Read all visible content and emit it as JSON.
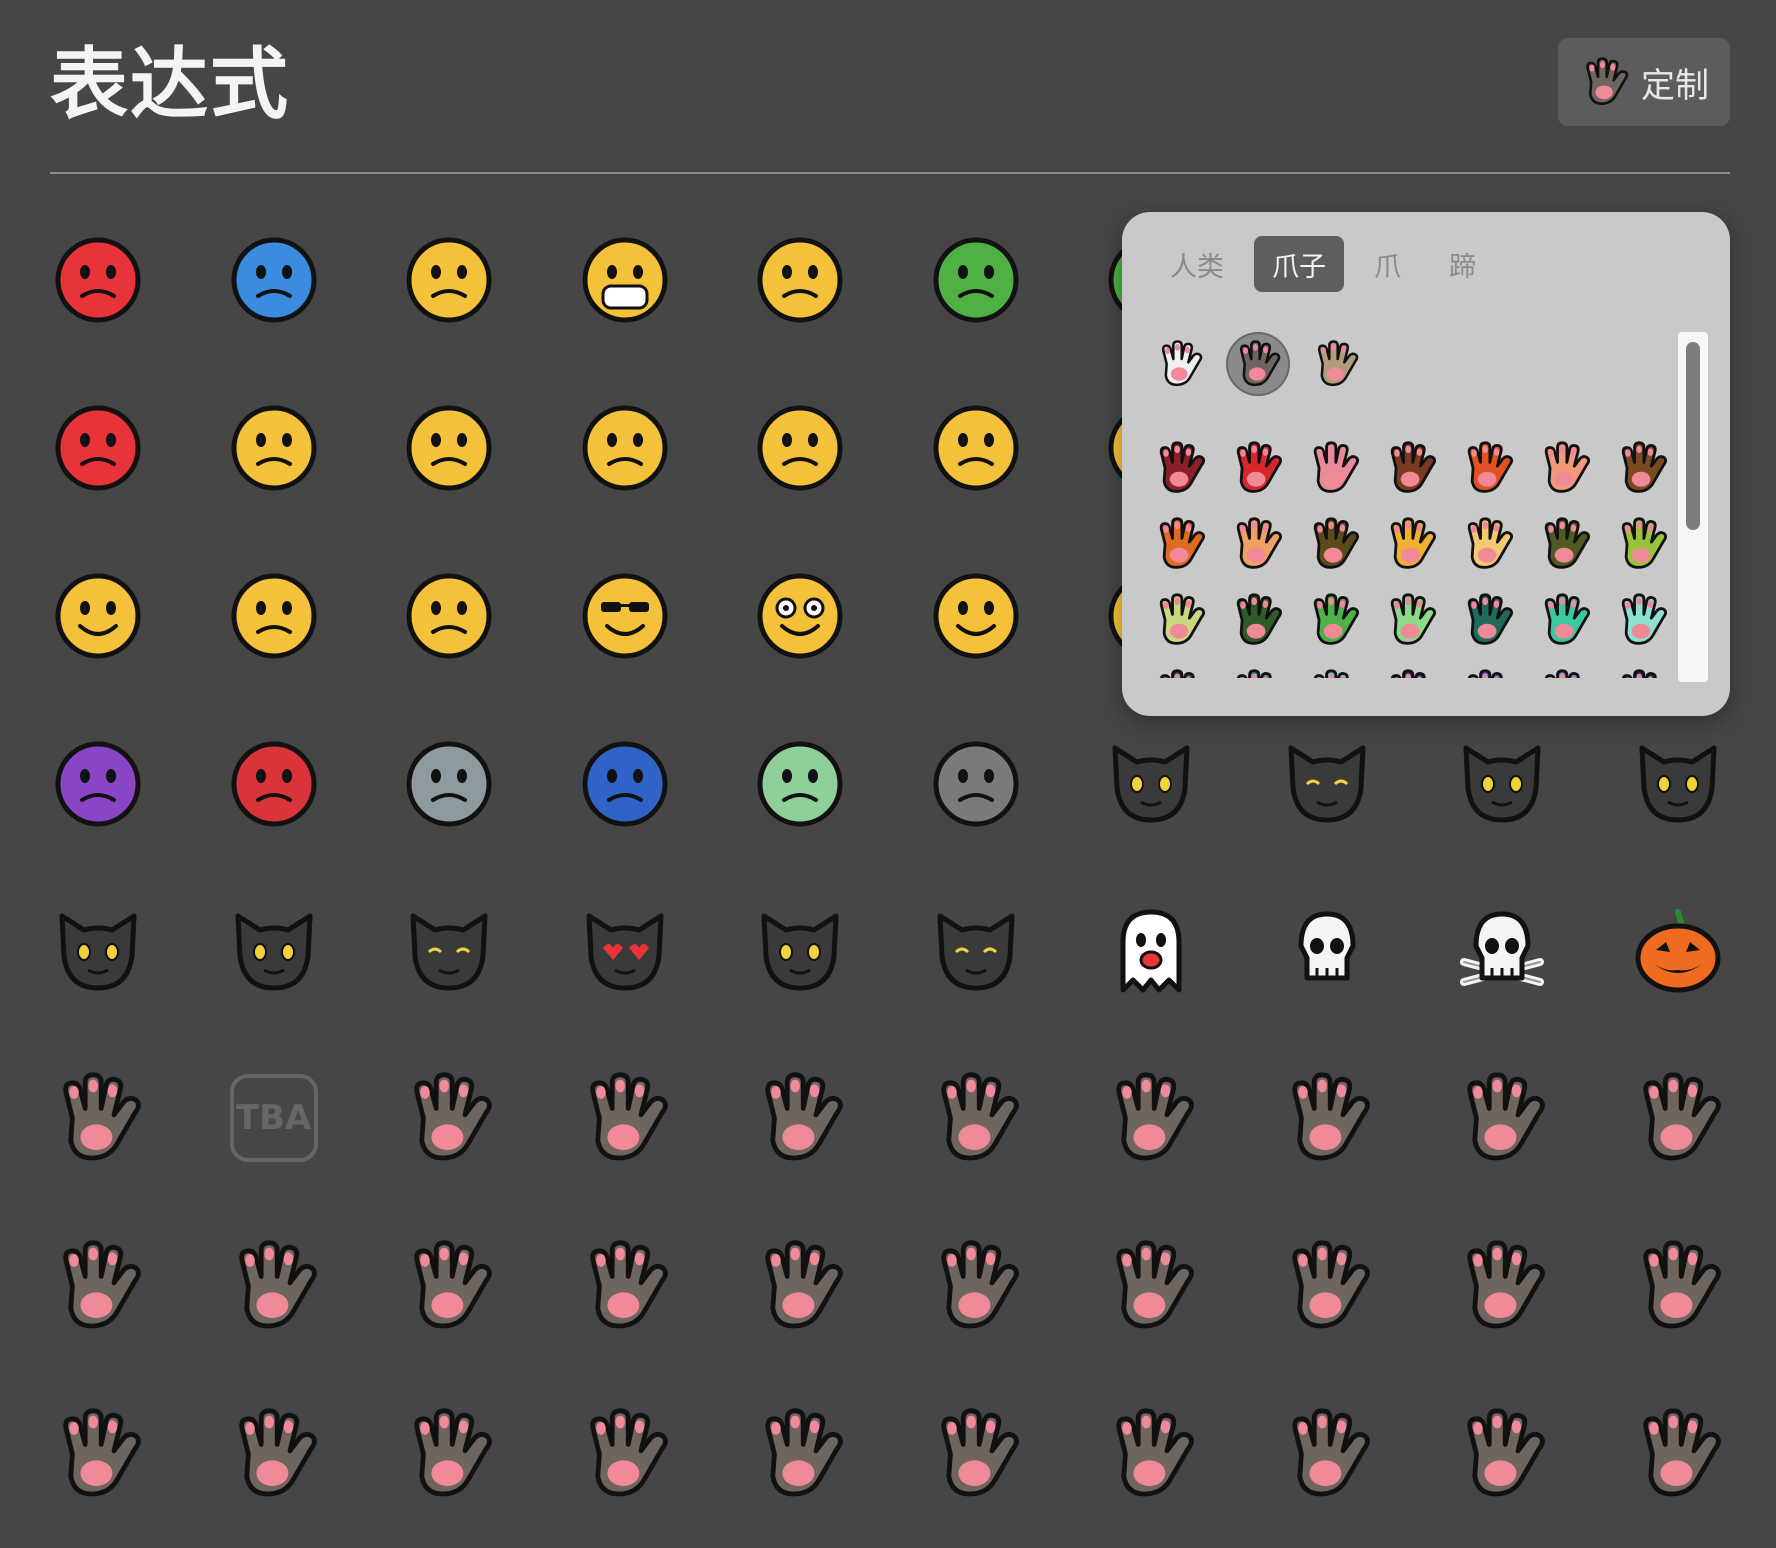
{
  "header": {
    "title": "表达式",
    "customize_label": "定制",
    "customize_icon": "paw-hand-icon"
  },
  "emoji_grid": [
    {
      "name": "angry-sweat-face",
      "icon": "face",
      "color": "#e8333a"
    },
    {
      "name": "freezing-face",
      "icon": "face",
      "color": "#3b8be0"
    },
    {
      "name": "bandaged-face",
      "icon": "face",
      "color": "#f4c13a"
    },
    {
      "name": "mask-face",
      "icon": "face",
      "color": "#f4c13a"
    },
    {
      "name": "vomiting-face",
      "icon": "face",
      "color": "#f4c13a"
    },
    {
      "name": "thermometer-face",
      "icon": "face",
      "color": "#4fb044"
    },
    {
      "name": "sick-face",
      "icon": "face",
      "color": "#4fb044"
    },
    {
      "name": "blank-1",
      "icon": "none",
      "color": ""
    },
    {
      "name": "blank-2",
      "icon": "none",
      "color": ""
    },
    {
      "name": "blank-3",
      "icon": "none",
      "color": ""
    },
    {
      "name": "angry-red-face",
      "icon": "face",
      "color": "#e8333a"
    },
    {
      "name": "cursing-face",
      "icon": "face",
      "color": "#f4c13a"
    },
    {
      "name": "sad-sweat-face",
      "icon": "face",
      "color": "#f4c13a"
    },
    {
      "name": "confused-face",
      "icon": "face",
      "color": "#f4c13a"
    },
    {
      "name": "frowning-face",
      "icon": "face",
      "color": "#f4c13a"
    },
    {
      "name": "sad-face",
      "icon": "face",
      "color": "#f4c13a"
    },
    {
      "name": "worried-face",
      "icon": "face",
      "color": "#f4c13a"
    },
    {
      "name": "blank-4",
      "icon": "none",
      "color": ""
    },
    {
      "name": "blank-5",
      "icon": "none",
      "color": ""
    },
    {
      "name": "blank-6",
      "icon": "none",
      "color": ""
    },
    {
      "name": "smile-sweat-face",
      "icon": "face",
      "color": "#f4c13a"
    },
    {
      "name": "tear-face",
      "icon": "face",
      "color": "#f4c13a"
    },
    {
      "name": "crying-face",
      "icon": "face",
      "color": "#f4c13a"
    },
    {
      "name": "sunglasses-face",
      "icon": "face",
      "color": "#f4c13a"
    },
    {
      "name": "nerd-face",
      "icon": "face",
      "color": "#f4c13a"
    },
    {
      "name": "cowboy-face",
      "icon": "face",
      "color": "#f4c13a"
    },
    {
      "name": "clown-face",
      "icon": "face",
      "color": "#f4c13a"
    },
    {
      "name": "blank-7",
      "icon": "none",
      "color": ""
    },
    {
      "name": "blank-8",
      "icon": "none",
      "color": ""
    },
    {
      "name": "blank-9",
      "icon": "none",
      "color": ""
    },
    {
      "name": "devil-face",
      "icon": "face",
      "color": "#8a45c7"
    },
    {
      "name": "ogre-face",
      "icon": "face",
      "color": "#d8343a"
    },
    {
      "name": "robot-face",
      "icon": "face",
      "color": "#8f9aa0"
    },
    {
      "name": "space-invader",
      "icon": "face",
      "color": "#2f63c8"
    },
    {
      "name": "alien-face",
      "icon": "face",
      "color": "#8fcf9a"
    },
    {
      "name": "block-face",
      "icon": "face",
      "color": "#7a7a7a"
    },
    {
      "name": "cat-face-grin",
      "icon": "cat",
      "color": "#3a3a3a"
    },
    {
      "name": "cat-face-smile",
      "icon": "cat",
      "color": "#3a3a3a"
    },
    {
      "name": "cat-face-tears",
      "icon": "cat",
      "color": "#3a3a3a"
    },
    {
      "name": "cat-face-smirk",
      "icon": "cat",
      "color": "#3a3a3a"
    },
    {
      "name": "cat-face-angry",
      "icon": "cat",
      "color": "#3a3a3a"
    },
    {
      "name": "cat-face-sweat",
      "icon": "cat",
      "color": "#3a3a3a"
    },
    {
      "name": "cat-face-kiss",
      "icon": "cat",
      "color": "#3a3a3a"
    },
    {
      "name": "cat-face-hearts",
      "icon": "cat",
      "color": "#3a3a3a"
    },
    {
      "name": "cat-face-shocked",
      "icon": "cat",
      "color": "#3a3a3a"
    },
    {
      "name": "cat-face-content",
      "icon": "cat",
      "color": "#3a3a3a"
    },
    {
      "name": "ghost",
      "icon": "ghost",
      "color": "#ffffff"
    },
    {
      "name": "skull",
      "icon": "skull",
      "color": "#f4f4f4"
    },
    {
      "name": "skull-crossbones",
      "icon": "skull",
      "color": "#f4f4f4"
    },
    {
      "name": "jack-o-lantern",
      "icon": "pumpkin",
      "color": "#ef6b1f"
    },
    {
      "name": "paw-hand",
      "icon": "hand",
      "color": "#6e655e"
    },
    {
      "name": "tba-placeholder",
      "icon": "tba",
      "color": "#666666",
      "text": "TBA"
    },
    {
      "name": "raised-hand",
      "icon": "hand",
      "color": "#6e655e"
    },
    {
      "name": "victory-hand",
      "icon": "hand",
      "color": "#6e655e"
    },
    {
      "name": "crossed-fingers",
      "icon": "hand",
      "color": "#6e655e"
    },
    {
      "name": "index-up",
      "icon": "hand",
      "color": "#6e655e"
    },
    {
      "name": "love-you-hand",
      "icon": "hand",
      "color": "#6e655e"
    },
    {
      "name": "vulcan-salute",
      "icon": "hand",
      "color": "#6e655e"
    },
    {
      "name": "thumbs-up",
      "icon": "hand",
      "color": "#6e655e"
    },
    {
      "name": "thumbs-down",
      "icon": "hand",
      "color": "#6e655e"
    },
    {
      "name": "call-me-hand",
      "icon": "hand",
      "color": "#6e655e"
    },
    {
      "name": "middle-finger",
      "icon": "hand",
      "color": "#6e655e"
    },
    {
      "name": "index-pointing-up",
      "icon": "hand",
      "color": "#6e655e"
    },
    {
      "name": "pointing-down",
      "icon": "hand",
      "color": "#6e655e"
    },
    {
      "name": "pointing-left",
      "icon": "hand",
      "color": "#6e655e"
    },
    {
      "name": "pointing-right",
      "icon": "hand",
      "color": "#6e655e"
    },
    {
      "name": "raised-fist",
      "icon": "hand",
      "color": "#6e655e"
    },
    {
      "name": "left-fist",
      "icon": "hand",
      "color": "#6e655e"
    },
    {
      "name": "right-fist",
      "icon": "hand",
      "color": "#6e655e"
    },
    {
      "name": "oncoming-fist",
      "icon": "hand",
      "color": "#6e655e"
    },
    {
      "name": "ok-hand",
      "icon": "hand",
      "color": "#6e655e"
    },
    {
      "name": "pinched-fingers",
      "icon": "hand",
      "color": "#6e655e"
    },
    {
      "name": "waving-hand",
      "icon": "hand",
      "color": "#6e655e"
    },
    {
      "name": "clapping-hands",
      "icon": "hand",
      "color": "#6e655e"
    },
    {
      "name": "raising-hands",
      "icon": "hand",
      "color": "#6e655e"
    },
    {
      "name": "open-hands",
      "icon": "hand",
      "color": "#6e655e"
    },
    {
      "name": "palms-up",
      "icon": "hand",
      "color": "#6e655e"
    },
    {
      "name": "folded-hands",
      "icon": "hand",
      "color": "#6e655e"
    },
    {
      "name": "writing-hand",
      "icon": "hand",
      "color": "#6e655e"
    },
    {
      "name": "flexed-biceps",
      "icon": "hand",
      "color": "#6e655e"
    }
  ],
  "popup": {
    "tabs": [
      {
        "label": "人类",
        "active": false
      },
      {
        "label": "爪子",
        "active": true
      },
      {
        "label": "爪",
        "active": false
      },
      {
        "label": "蹄",
        "active": false
      }
    ],
    "tones": [
      {
        "name": "tone-white",
        "color": "#f0f0f0",
        "selected": false
      },
      {
        "name": "tone-gray",
        "color": "#6e655e",
        "selected": true
      },
      {
        "name": "tone-tan",
        "color": "#b39a7a",
        "selected": false
      }
    ],
    "colors": [
      "#8b1f2b",
      "#d8262c",
      "#e88a9a",
      "#7a3a22",
      "#e0521f",
      "#f09a7a",
      "#7a4a22",
      "#e06a1f",
      "#f0a060",
      "#5c4a1a",
      "#f0b030",
      "#f2c870",
      "#4f5a22",
      "#9ac23a",
      "#c8d880",
      "#2f5a2a",
      "#4fb04a",
      "#8ed88a",
      "#1f6a5a",
      "#3ac8a0",
      "#8ee0d0",
      "#1f5a6a",
      "#2a9ab0",
      "#70c0d8",
      "#1f3a7a",
      "#3a6ad0",
      "#6a8ae0",
      "#2a2a7a"
    ]
  }
}
